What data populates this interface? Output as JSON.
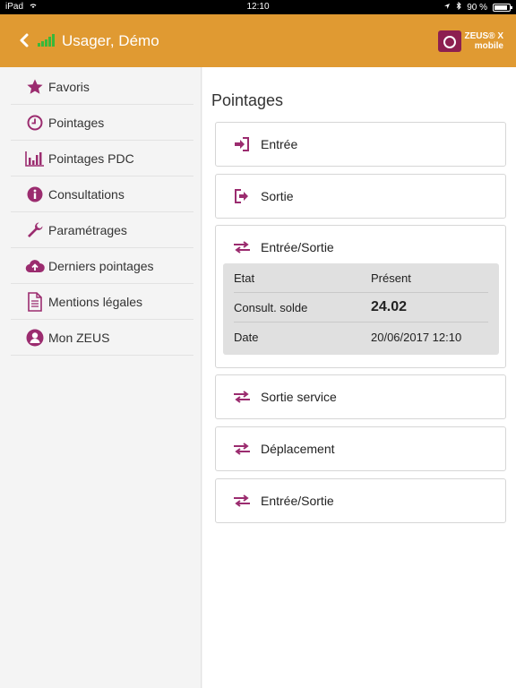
{
  "status_bar": {
    "device": "iPad",
    "time": "12:10",
    "battery": "90 %",
    "battery_level": 0.9
  },
  "header": {
    "title": "Usager, Démo",
    "logo_line1": "ZEUS® X",
    "logo_line2": "mobile"
  },
  "colors": {
    "accent": "#e09a32",
    "icon": "#9b2c6f"
  },
  "sidebar": {
    "items": [
      {
        "label": "Favoris",
        "icon": "star-icon"
      },
      {
        "label": "Pointages",
        "icon": "clock-icon"
      },
      {
        "label": "Pointages PDC",
        "icon": "bar-chart-icon"
      },
      {
        "label": "Consultations",
        "icon": "info-icon"
      },
      {
        "label": "Paramétrages",
        "icon": "wrench-icon"
      },
      {
        "label": "Derniers pointages",
        "icon": "cloud-upload-icon"
      },
      {
        "label": "Mentions légales",
        "icon": "document-icon"
      },
      {
        "label": "Mon ZEUS",
        "icon": "user-icon"
      }
    ]
  },
  "main": {
    "title": "Pointages",
    "actions": [
      {
        "label": "Entrée",
        "icon": "sign-in-icon"
      },
      {
        "label": "Sortie",
        "icon": "sign-out-icon"
      },
      {
        "label": "Entrée/Sortie",
        "icon": "exchange-icon"
      },
      {
        "label": "Sortie service",
        "icon": "exchange-icon"
      },
      {
        "label": "Déplacement",
        "icon": "exchange-icon"
      },
      {
        "label": "Entrée/Sortie",
        "icon": "exchange-icon"
      }
    ],
    "details": [
      {
        "key": "Etat",
        "value": "Présent"
      },
      {
        "key": "Consult. solde",
        "value": "24.02"
      },
      {
        "key": "Date",
        "value": "20/06/2017 12:10"
      }
    ]
  }
}
